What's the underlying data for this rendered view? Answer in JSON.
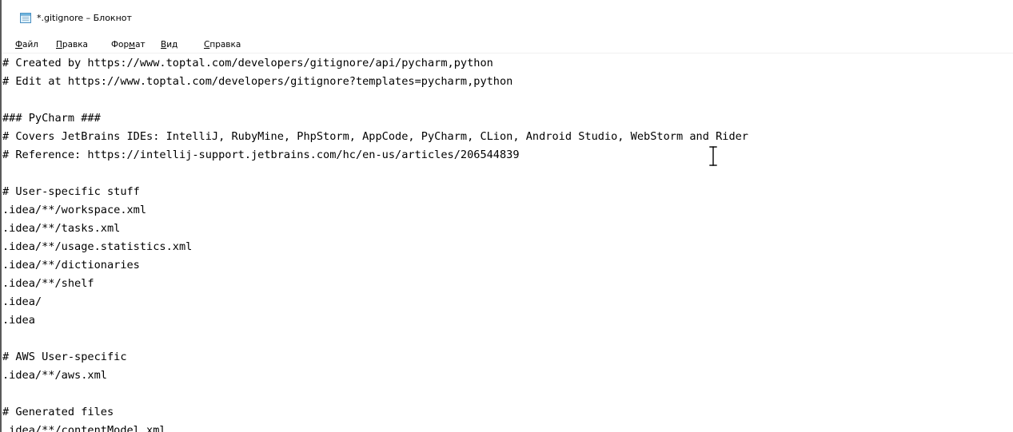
{
  "window": {
    "title": "*.gitignore – Блокнот",
    "icon": "notepad-icon"
  },
  "menu": [
    {
      "mnemonic": "Ф",
      "rest": "айл"
    },
    {
      "mnemonic": "П",
      "rest": "равка"
    },
    {
      "pre": "Фор",
      "mnemonic": "м",
      "rest": "ат"
    },
    {
      "mnemonic": "В",
      "rest": "ид"
    },
    {
      "mnemonic": "С",
      "rest": "правка"
    }
  ],
  "editor": {
    "lines": [
      "# Created by https://www.toptal.com/developers/gitignore/api/pycharm,python",
      "# Edit at https://www.toptal.com/developers/gitignore?templates=pycharm,python",
      "",
      "### PyCharm ###",
      "# Covers JetBrains IDEs: IntelliJ, RubyMine, PhpStorm, AppCode, PyCharm, CLion, Android Studio, WebStorm and Rider",
      "# Reference: https://intellij-support.jetbrains.com/hc/en-us/articles/206544839",
      "",
      "# User-specific stuff",
      ".idea/**/workspace.xml",
      ".idea/**/tasks.xml",
      ".idea/**/usage.statistics.xml",
      ".idea/**/dictionaries",
      ".idea/**/shelf",
      ".idea/",
      ".idea",
      "",
      "# AWS User-specific",
      ".idea/**/aws.xml",
      "",
      "# Generated files",
      ".idea/**/contentModel.xml"
    ]
  },
  "cursor_icon": "text-cursor-icon"
}
